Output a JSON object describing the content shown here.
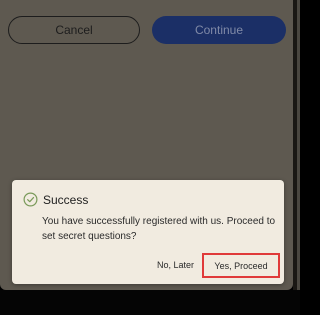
{
  "top_buttons": {
    "cancel_label": "Cancel",
    "continue_label": "Continue"
  },
  "dialog": {
    "icon": "check-circle-icon",
    "title": "Success",
    "message": "You have successfully registered with us. Proceed to set secret questions?",
    "no_label": "No, Later",
    "yes_label": "Yes, Proceed"
  },
  "colors": {
    "background_dim": "#5e5950",
    "continue_button": "#1b2f66",
    "dialog_background": "#f1ebe0",
    "success_green": "#7a9a5a",
    "highlight_outline": "#e03a3a"
  }
}
